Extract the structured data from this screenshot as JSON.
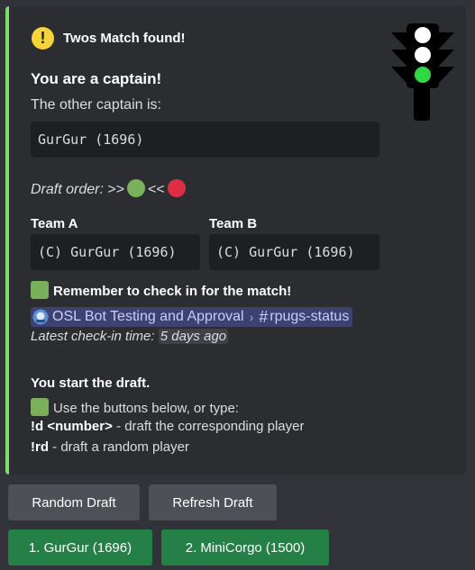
{
  "embed": {
    "accent_color": "#7fdd6c",
    "author_icon": "warning-icon",
    "author_text": "Twos Match found!",
    "title": "You are a captain!",
    "other_captain_label": "The other captain is:",
    "other_captain_value": "GurGur (1696)",
    "draft_order_label": "Draft order:",
    "draft_order_sep1": ">>",
    "draft_order_sep2": "<<",
    "draft_order_colors": [
      "#78b159",
      "#dd2e44"
    ],
    "team_a": {
      "name": "Team A",
      "value": "(C) GurGur (1696)"
    },
    "team_b": {
      "name": "Team B",
      "value": "(C) GurGur (1696)"
    },
    "checkin_reminder": "Remember to check in for the match!",
    "channel": {
      "server": "OSL Bot Testing and Approval",
      "name": "rpugs-status"
    },
    "checkin_time_label": "Latest check-in time:",
    "checkin_time_value": "5 days ago",
    "draft_heading": "You start the draft.",
    "draft_instruction": "Use the buttons below, or type:",
    "cmd1": "!d <number>",
    "cmd1_desc": " - draft the corresponding player",
    "cmd2": "!rd",
    "cmd2_desc": " - draft a random player"
  },
  "thumbnail": {
    "name": "traffic-light",
    "light_colors": [
      "#ffffff",
      "#ffffff",
      "#31d843"
    ]
  },
  "buttons": {
    "random_draft": "Random Draft",
    "refresh_draft": "Refresh Draft",
    "player1": "1. GurGur (1696)",
    "player2": "2. MiniCorgo (1500)"
  }
}
